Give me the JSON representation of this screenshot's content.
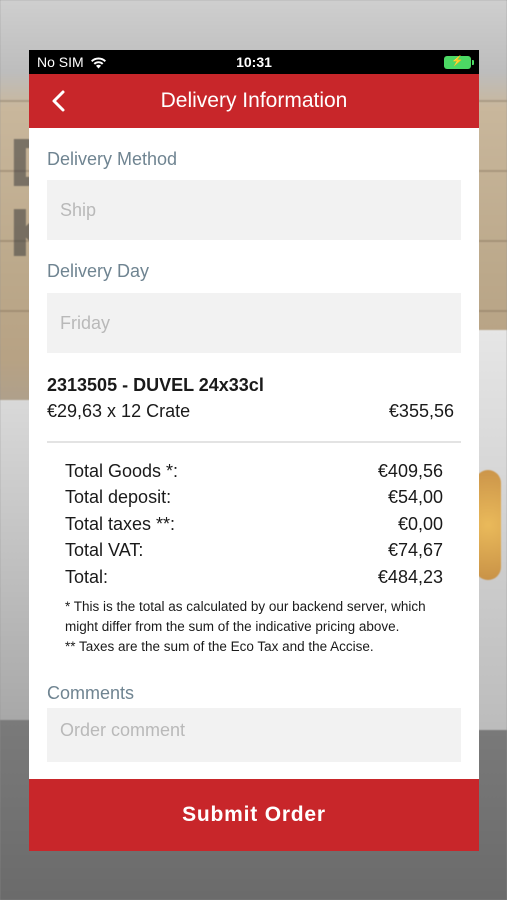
{
  "status_bar": {
    "carrier": "No SIM",
    "time": "10:31",
    "wifi_icon": "wifi-icon",
    "battery_icon": "battery-charging-icon"
  },
  "navbar": {
    "title": "Delivery Information",
    "back_icon": "chevron-left-icon"
  },
  "delivery_method": {
    "label": "Delivery Method",
    "value": "Ship"
  },
  "delivery_day": {
    "label": "Delivery Day",
    "value": "Friday"
  },
  "order_item": {
    "name": "2313505 - DUVEL 24x33cl",
    "unit_line": "€29,63 x 12 Crate",
    "line_total": "€355,56"
  },
  "totals": [
    {
      "label": "Total Goods *:",
      "value": "€409,56"
    },
    {
      "label": "Total deposit:",
      "value": "€54,00"
    },
    {
      "label": "Total taxes **:",
      "value": "€0,00"
    },
    {
      "label": "Total VAT:",
      "value": "€74,67"
    },
    {
      "label": "Total:",
      "value": "€484,23"
    }
  ],
  "notes": {
    "line1": "* This is the total as calculated by our backend server, which might differ from the sum of the indicative pricing above.",
    "line2": "** Taxes are the sum of the Eco Tax and the Accise."
  },
  "comments": {
    "label": "Comments",
    "placeholder": "Order comment"
  },
  "submit_label": "Submit Order",
  "colors": {
    "brand_red": "#c8262a",
    "label_grey_blue": "#6f8491",
    "field_bg": "#f2f2f2",
    "battery_green": "#4cd964"
  }
}
